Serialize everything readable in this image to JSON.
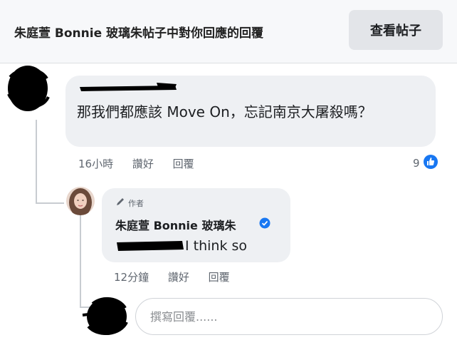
{
  "header": {
    "text": "朱庭萱 Bonnie 玻璃朱帖子中對你回應的回覆",
    "view_button": "查看帖子",
    "background": "#f7f8fa"
  },
  "comment": {
    "text": "那我們都應該 Move On，忘記南京大屠殺嗎？",
    "time": "16小時",
    "like": "讚好",
    "reply": "回覆",
    "reaction_count": "9",
    "reaction_icon": "like-icon",
    "bubble_color": "#eef0f3"
  },
  "reply": {
    "author_badge": "作者",
    "author_name": "朱庭萱 Bonnie 玻璃朱",
    "verified_icon": "verified-badge-icon",
    "text": "I think so",
    "time": "12分鐘",
    "like": "讚好",
    "reply": "回覆"
  },
  "compose": {
    "placeholder": "撰寫回覆......"
  },
  "colors": {
    "accent": "#1877f2",
    "meta_text": "#606770",
    "redaction": "#000000"
  }
}
